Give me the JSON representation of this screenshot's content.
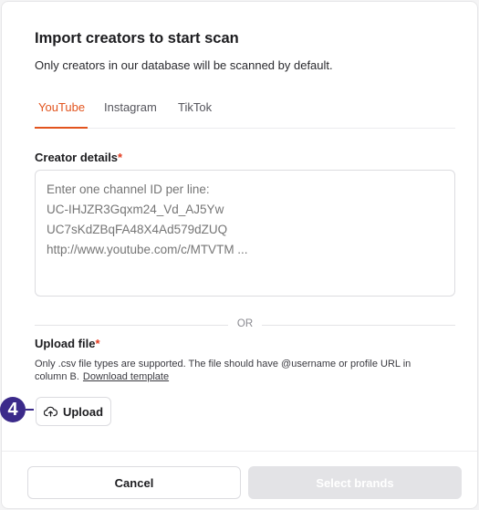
{
  "dialog": {
    "title": "Import creators to start scan",
    "subtitle": "Only creators in our database will be scanned by default."
  },
  "tabs": [
    {
      "label": "YouTube",
      "active": true
    },
    {
      "label": "Instagram",
      "active": false
    },
    {
      "label": "TikTok",
      "active": false
    }
  ],
  "creator_details": {
    "label": "Creator details",
    "required_mark": "*",
    "placeholder": "Enter one channel ID per line:\nUC-IHJZR3Gqxm24_Vd_AJ5Yw\nUC7sKdZBqFA48X4Ad579dZUQ\nhttp://www.youtube.com/c/MTVTM ...",
    "value": ""
  },
  "divider_text": "OR",
  "upload_file": {
    "label": "Upload file",
    "required_mark": "*",
    "help_text": "Only .csv file types are supported. The file should have @username or profile URL in column B.",
    "template_link": "Download template",
    "button_label": "Upload",
    "icon": "cloud-upload-icon"
  },
  "step_badge": "4",
  "footer": {
    "cancel_label": "Cancel",
    "submit_label": "Select brands"
  },
  "colors": {
    "accent": "#e2541e",
    "required": "#e23a1f",
    "badge": "#3b2a8a",
    "disabled_button": "#e3e3e6"
  }
}
